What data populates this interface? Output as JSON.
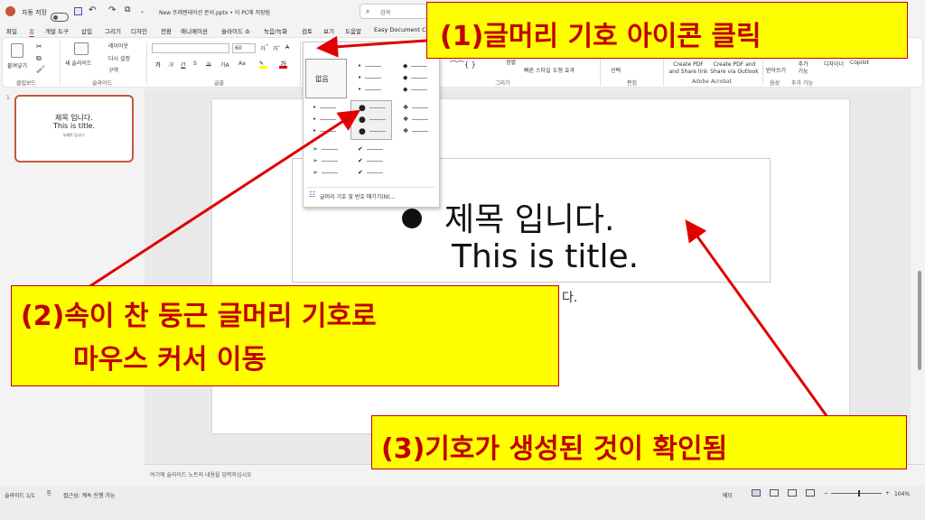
{
  "titlebar": {
    "autosave_label": "자동 저장",
    "doc_title": "New 프레젠테이션 문서.pptx • 이 PC에 저장됨",
    "search_placeholder": "검색"
  },
  "tabs": [
    "파일",
    "홈",
    "개발 도구",
    "삽입",
    "그리기",
    "디자인",
    "전환",
    "애니메이션",
    "슬라이드 쇼",
    "녹음/녹화",
    "검토",
    "보기",
    "도움말",
    "Easy Document Cr"
  ],
  "active_tab": "홈",
  "ribbon": {
    "clipboard": {
      "paste": "붙여넣기",
      "group": "클립보드"
    },
    "slides": {
      "new_slide": "새 슬라이드",
      "layout": "레이아웃",
      "reset": "다시 설정",
      "section": "구역",
      "group": "슬라이드"
    },
    "font": {
      "size": "60",
      "group": "글꼴",
      "buttons": [
        "가",
        "가",
        "간",
        "S",
        "가",
        "가A",
        "Aa"
      ]
    },
    "drawing": {
      "group": "그리기",
      "arrange": "정렬",
      "quick_styles": "빠른 스타일",
      "shape_effects": "도형 효과"
    },
    "editing": {
      "select": "선택",
      "group": "편집"
    },
    "acrobat": {
      "create_pdf": "Create PDF and Share link",
      "create_pdf_outlook": "Create PDF and Share via Outlook",
      "group": "Adobe Acrobat"
    },
    "voice": {
      "dictate": "받아쓰기",
      "group": "음성"
    },
    "addins": {
      "label": "추가 기능",
      "group": "추가 기능"
    },
    "designer": "디자이너",
    "copilot": "Copilot"
  },
  "bullet_menu": {
    "none_label": "없음",
    "footer": "글머리 기호 및 번호 매기기(N)..."
  },
  "thumbnail": {
    "number": "1",
    "title": "제목 입니다.",
    "subtitle": "This is title.",
    "body": "부제목 입니다."
  },
  "slide": {
    "title_line1": "제목 입니다.",
    "title_line2": "This is title.",
    "subtitle_partial": "다."
  },
  "notes_placeholder": "여기에 슬라이드 노트의 내용을 입력하십시오",
  "status": {
    "slide_count": "슬라이드 1/1",
    "accessibility": "접근성: 계속 진행 가능",
    "notes_btn": "메모",
    "zoom": "104%"
  },
  "callouts": {
    "c1": "(1)글머리 기호 아이콘 클릭",
    "c2_line1": "(2)속이 찬 둥근 글머리 기호로",
    "c2_line2": "마우스 커서 이동",
    "c3": "(3)기호가 생성된 것이 확인됨"
  },
  "colors": {
    "accent": "#b7472a",
    "callout_bg": "#ffff00",
    "callout_text": "#c00000",
    "arrow": "#e00000"
  }
}
